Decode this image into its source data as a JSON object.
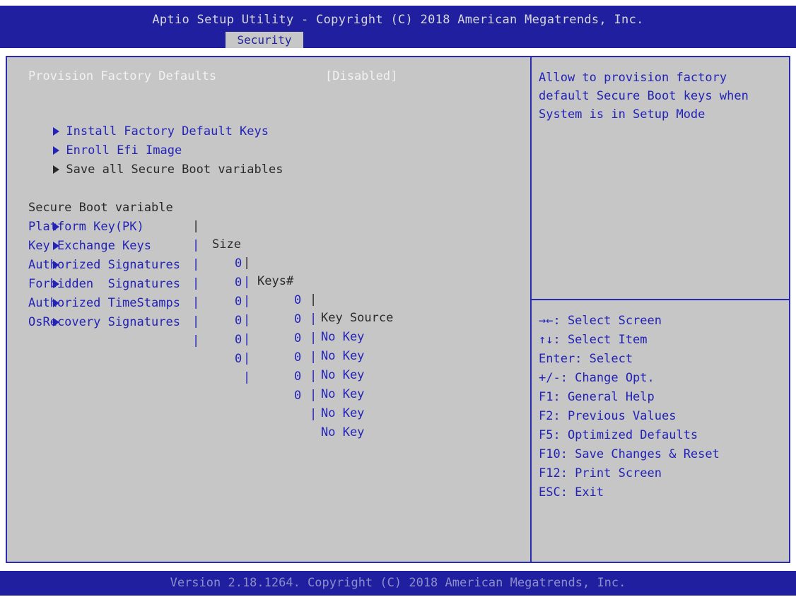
{
  "header": {
    "title": "Aptio Setup Utility - Copyright (C) 2018 American Megatrends, Inc.",
    "active_tab": "Security"
  },
  "settings": {
    "provision_label": "Provision Factory Defaults",
    "provision_value": "[Disabled]",
    "submenus": [
      "Install Factory Default Keys",
      "Enroll Efi Image",
      "Save all Secure Boot variables"
    ]
  },
  "table": {
    "columns": [
      "Secure Boot variable",
      "Size",
      "Keys#",
      "Key Source"
    ],
    "rows": [
      {
        "name": "Platform Key(PK)",
        "size": "0",
        "keys": "0",
        "source": "No Key"
      },
      {
        "name": "Key Exchange Keys",
        "size": "0",
        "keys": "0",
        "source": "No Key"
      },
      {
        "name": "Authorized Signatures",
        "size": "0",
        "keys": "0",
        "source": "No Key"
      },
      {
        "name": "Forbidden  Signatures",
        "size": "0",
        "keys": "0",
        "source": "No Key"
      },
      {
        "name": "Authorized TimeStamps",
        "size": "0",
        "keys": "0",
        "source": "No Key"
      },
      {
        "name": "OsRecovery Signatures",
        "size": "0",
        "keys": "0",
        "source": "No Key"
      }
    ]
  },
  "help": {
    "lines": [
      "Allow to provision factory",
      "default Secure Boot keys when",
      "System is in Setup Mode"
    ]
  },
  "keys": {
    "lines": [
      "→←: Select Screen",
      "↑↓: Select Item",
      "Enter: Select",
      "+/-: Change Opt.",
      "F1: General Help",
      "F2: Previous Values",
      "F5: Optimized Defaults",
      "F10: Save Changes & Reset",
      "F12: Print Screen",
      "ESC: Exit"
    ]
  },
  "footer": {
    "text": "Version 2.18.1264. Copyright (C) 2018 American Megatrends, Inc."
  },
  "colors": {
    "header_bg": "#1f1fa0",
    "body_bg": "#c6c6c6",
    "accent_text": "#2323b8",
    "highlight_text": "#f2f2f2"
  }
}
